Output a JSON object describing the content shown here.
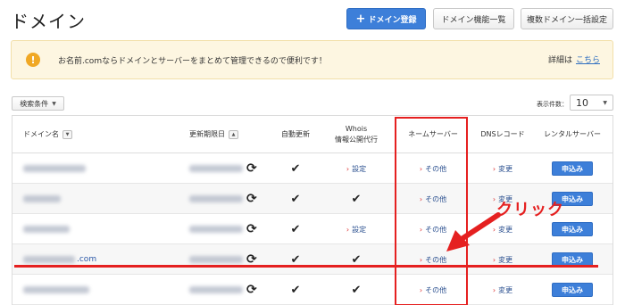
{
  "page": {
    "title": "ドメイン"
  },
  "toolbar": {
    "register_plus": "+",
    "register_label": "ドメイン登録",
    "features_label": "ドメイン機能一覧",
    "bulk_label": "複数ドメイン一括設定"
  },
  "notice": {
    "icon": "!",
    "text": "お名前.comならドメインとサーバーをまとめて管理できるので便利です！",
    "details_prefix": "詳細は",
    "details_link": "こちら"
  },
  "filter": {
    "label": "検索条件",
    "caret": "▼"
  },
  "pagination": {
    "label": "表示件数：",
    "value": "10",
    "caret": "▼"
  },
  "table": {
    "headers": {
      "domain": "ドメイン名",
      "domain_sort": "▼",
      "renewal": "更新期限日",
      "renewal_sort": "▲",
      "auto_renew": "自動更新",
      "whois_line1": "Whois",
      "whois_line2": "情報公開代行",
      "nameserver": "ネームサーバー",
      "dns": "DNSレコード",
      "rental": "レンタルサーバー"
    },
    "rows": [
      {
        "domain_suffix": "",
        "auto_renew": "✔",
        "whois": "設定",
        "whois_type": "link",
        "nameserver": "その他",
        "dns": "変更",
        "rental": "申込み"
      },
      {
        "domain_suffix": "",
        "auto_renew": "✔",
        "whois": "✔",
        "whois_type": "check",
        "nameserver": "その他",
        "dns": "変更",
        "rental": "申込み"
      },
      {
        "domain_suffix": "",
        "auto_renew": "✔",
        "whois": "設定",
        "whois_type": "link",
        "nameserver": "その他",
        "dns": "変更",
        "rental": "申込み"
      },
      {
        "domain_suffix": ".com",
        "auto_renew": "✔",
        "whois": "✔",
        "whois_type": "check",
        "nameserver": "その他",
        "dns": "変更",
        "rental": "申込み"
      },
      {
        "domain_suffix": "",
        "auto_renew": "✔",
        "whois": "✔",
        "whois_type": "check",
        "nameserver": "その他",
        "dns": "変更",
        "rental": "申込み"
      }
    ],
    "refresh_icon": "⟳",
    "link_arrow": "›"
  },
  "annotation": {
    "text": "クリック",
    "color": "#e52020"
  },
  "colors": {
    "primary": "#3d7fd9",
    "accent_red": "#e52020",
    "notice_bg": "#fdf6e1"
  }
}
